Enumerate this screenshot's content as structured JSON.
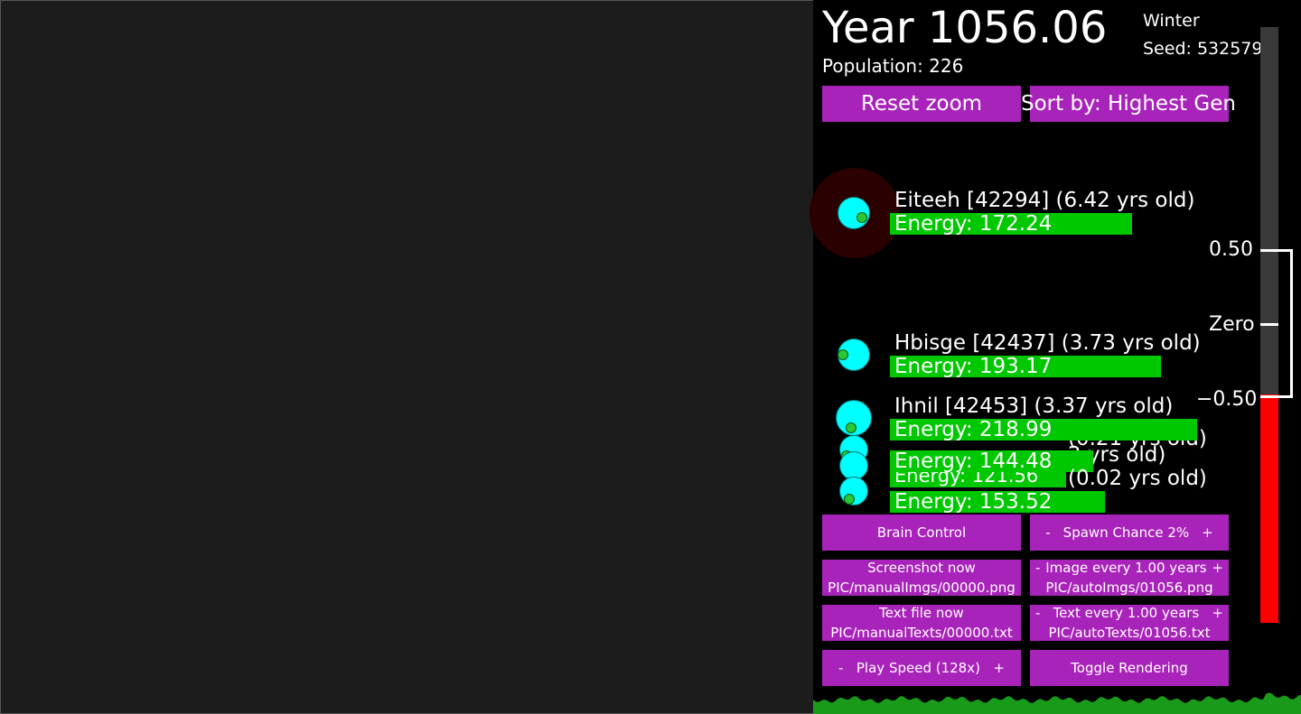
{
  "header": {
    "year": "Year 1056.06",
    "population": "Population: 226",
    "season": "Winter",
    "seed": "Seed: 532579"
  },
  "top_buttons": {
    "reset_zoom": "Reset zoom",
    "sort_by": "Sort by: Highest Gen"
  },
  "creatures": [
    {
      "name": "Eiteeh [42294] (6.42 yrs old)",
      "energy": "Energy: 172.24",
      "energy_value": 172.24
    },
    {
      "name": "Hbisge [42437] (3.73 yrs old)",
      "energy": "Energy: 193.17",
      "energy_value": 193.17
    },
    {
      "name": "Ihnil [42453] (3.37 yrs old)",
      "energy": "Energy: 218.99",
      "energy_value": 218.99
    },
    {
      "name": "(0.21 yrs old)",
      "energy": "Energy: 144.48",
      "energy_value": 144.48
    },
    {
      "name": "2 yrs old)",
      "energy": "Energy: 121.56",
      "energy_value": 121.56
    },
    {
      "name": "(0.02 yrs old)",
      "energy": "Energy: 153.52",
      "energy_value": 153.52
    }
  ],
  "controls": {
    "brain_control": "Brain Control",
    "spawn_minus": "-",
    "spawn_label": "Spawn Chance 2%",
    "spawn_plus": "+",
    "screenshot_now": "Screenshot now",
    "screenshot_path": "PIC/manualImgs/00000.png",
    "image_minus": "-",
    "image_every": "Image every 1.00 years",
    "image_plus": "+",
    "image_path": "PIC/autoImgs/01056.png",
    "textfile_now": "Text file now",
    "textfile_path": "PIC/manualTexts/00000.txt",
    "text_minus": "-",
    "text_every": "Text every 1.00 years",
    "text_plus": "+",
    "text_path": "PIC/autoTexts/01056.txt",
    "speed_minus": "-",
    "play_speed": "Play Speed (128x)",
    "speed_plus": "+",
    "toggle_rendering": "Toggle Rendering"
  },
  "meter": {
    "label_high": "0.50",
    "label_zero": "Zero",
    "label_low": "−0.50",
    "fill_color": "#ff0000",
    "track_color": "#3a3a3a"
  },
  "colors": {
    "button": "#a823b9",
    "energy": "#00c800",
    "creature_body": "#00ffff",
    "graph": "#1a9a1a"
  }
}
